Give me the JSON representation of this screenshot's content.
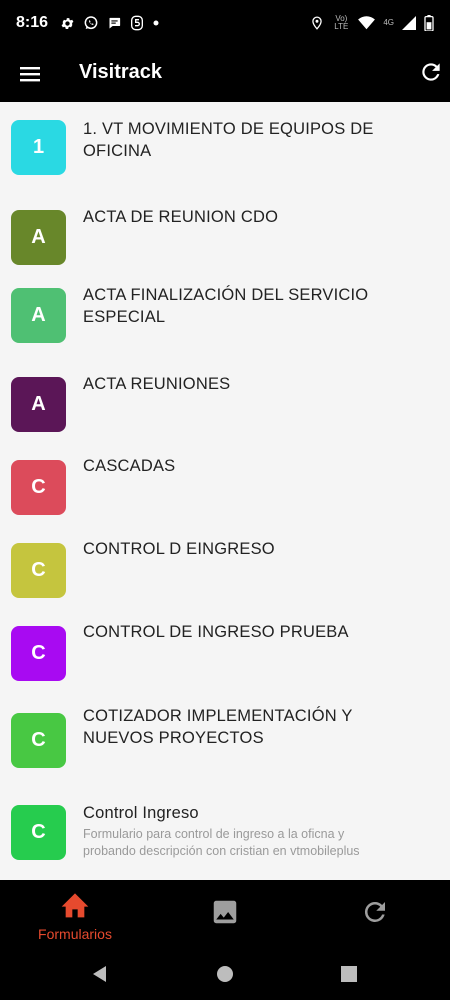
{
  "status_bar": {
    "time": "8:16",
    "left_icons": [
      "gear-icon",
      "whatsapp-icon",
      "chat-icon",
      "five-icon",
      "dot-icon"
    ],
    "right_icons": [
      "location-icon",
      "volte-icon",
      "wifi-icon",
      "signal-icon",
      "battery-icon"
    ],
    "volte_text": "Vo) LTE",
    "network_text": "4G"
  },
  "app_bar": {
    "title": "Visitrack",
    "menu_icon": "hamburger-menu-icon",
    "refresh_icon": "refresh-icon"
  },
  "forms": [
    {
      "letter": "1",
      "color": "#2ad9e3",
      "title": "1. VT MOVIMIENTO DE EQUIPOS DE OFICINA"
    },
    {
      "letter": "A",
      "color": "#68872a",
      "title": "ACTA DE REUNION CDO"
    },
    {
      "letter": "A",
      "color": "#4fc073",
      "title": "ACTA FINALIZACIÓN DEL SERVICIO ESPECIAL"
    },
    {
      "letter": "A",
      "color": "#5b1657",
      "title": "ACTA REUNIONES"
    },
    {
      "letter": "C",
      "color": "#dc4b5b",
      "title": "CASCADAS"
    },
    {
      "letter": "C",
      "color": "#c5c53e",
      "title": "CONTROL D EINGRESO"
    },
    {
      "letter": "C",
      "color": "#a80af2",
      "title": "CONTROL DE INGRESO PRUEBA"
    },
    {
      "letter": "C",
      "color": "#48c843",
      "title": "COTIZADOR IMPLEMENTACIÓN Y NUEVOS PROYECTOS"
    },
    {
      "letter": "C",
      "color": "#26cc4e",
      "title": "Control Ingreso",
      "subtitle": "Formulario para control de ingreso a la oficna y probando descripción con cristian en vtmobileplus"
    }
  ],
  "bottom_nav": {
    "items": [
      {
        "label": "Formularios",
        "icon": "home-icon",
        "active": true
      },
      {
        "label": "",
        "icon": "image-icon",
        "active": false
      },
      {
        "label": "",
        "icon": "sync-icon",
        "active": false
      }
    ],
    "active_color": "#e64a2e",
    "inactive_color": "#9e9e9e"
  },
  "system_nav": {
    "icons": [
      "back-icon",
      "home-circle-icon",
      "recents-icon"
    ]
  }
}
